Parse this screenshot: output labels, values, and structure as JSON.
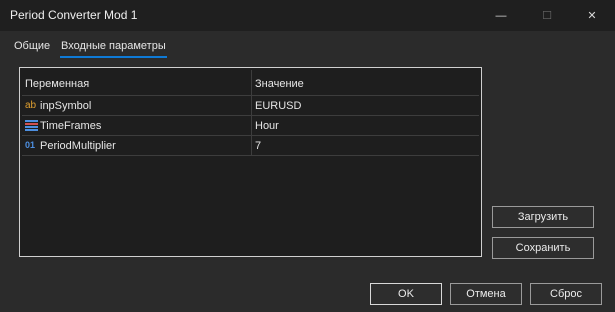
{
  "window": {
    "title": "Period Converter Mod 1",
    "controls": {
      "minimize": "—",
      "maximize": "☐",
      "close": "✕"
    }
  },
  "tabs": [
    {
      "label": "Общие",
      "active": false
    },
    {
      "label": "Входные параметры",
      "active": true
    }
  ],
  "table": {
    "headers": {
      "name": "Переменная",
      "value": "Значение"
    },
    "rows": [
      {
        "icon": "ab",
        "icon_name": "string-type-icon",
        "name": "inpSymbol",
        "value": "EURUSD"
      },
      {
        "icon": "",
        "icon_name": "enum-type-icon",
        "name": "TimeFrames",
        "value": "Hour"
      },
      {
        "icon": "01",
        "icon_name": "integer-type-icon",
        "name": "PeriodMultiplier",
        "value": "7"
      }
    ]
  },
  "buttons": {
    "load": "Загрузить",
    "save": "Сохранить",
    "ok": "OK",
    "cancel": "Отмена",
    "reset": "Сброс"
  },
  "colors": {
    "accent": "#0e7ad6",
    "background": "#2b2b2b",
    "titlebar": "#1f1f1f",
    "panel": "#1e1e1e"
  }
}
